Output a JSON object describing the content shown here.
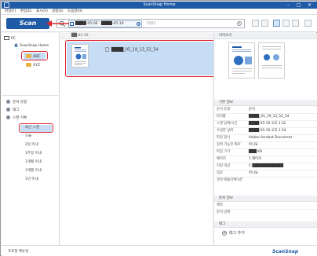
{
  "window": {
    "title": "ScanSnap Home",
    "min": "–",
    "max": "□",
    "close": "✕"
  },
  "menu": [
    "파일(F)",
    "편집(E)",
    "표시(V)",
    "설정(S)",
    "도움말(H)"
  ],
  "toolbar": {
    "scan_label": "Scan",
    "date_range": "████-05-06 - ████-05-19",
    "search_placeholder": "키워드",
    "clear": "×"
  },
  "tree": {
    "pc": "PC",
    "root": "ScanSnap Home",
    "folders": [
      "ABC",
      "XYZ"
    ]
  },
  "sections": [
    {
      "label": "문서 유형"
    },
    {
      "label": "태그"
    },
    {
      "label": "스캔 기록"
    }
  ],
  "history": [
    "최근 스캔",
    "오늘",
    "2일 이내",
    "1주일 이내",
    "1개월 이내",
    "3개월 이내",
    "1년 이내"
  ],
  "bottom_left": "프로필 매뉴얼",
  "center": {
    "header": "██-05-19",
    "document_name": "████_05_19_13_52_54"
  },
  "right": {
    "preview_header": "미리보기",
    "info_header": "기본 정보",
    "properties": [
      {
        "key": "문서 유형",
        "value": "문서"
      },
      {
        "key": "타이틀",
        "value": "████_05_19_13_52_54"
      },
      {
        "key": "스캔 날짜/시간",
        "value": "████-05-19 오후 1:52"
      },
      {
        "key": "수정한 날짜",
        "value": "████-05-19 오후 1:54"
      },
      {
        "key": "파일 형식",
        "value": "Adobe Acrobat Document"
      },
      {
        "key": "검색 가능한 PDF",
        "value": "아니요"
      },
      {
        "key": "파일 크기",
        "value": "███ KB"
      },
      {
        "key": "페이지",
        "value": "1 페이지"
      },
      {
        "key": "저장 대상",
        "value": "C:████████████"
      },
      {
        "key": "업로",
        "value": "아니요"
      },
      {
        "key": "관련 애플리케이션",
        "value": ""
      }
    ],
    "doc_info_header": "문서 정보",
    "doc_info": [
      {
        "key": "제목",
        "value": ""
      },
      {
        "key": "문서 날짜",
        "value": ""
      }
    ],
    "tag_header": "태그",
    "tag_add": "태그 추가"
  },
  "brand": "ScanSnap",
  "colors": {
    "accent": "#1f5aa6",
    "highlight": "#c7dcf5",
    "callout": "#e0282e"
  }
}
